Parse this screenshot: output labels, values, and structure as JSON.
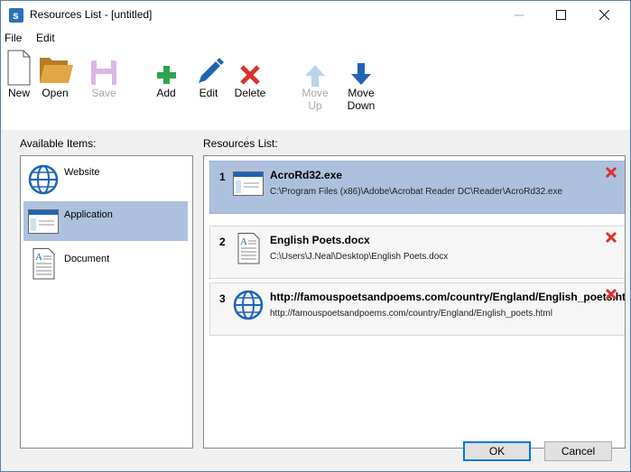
{
  "window": {
    "title": "Resources List - [untitled]",
    "icon": "app-logo-icon",
    "accent": "#2b73b6"
  },
  "menu": [
    "File",
    "Edit"
  ],
  "toolbar": {
    "new": "New",
    "open": "Open",
    "save": "Save",
    "add": "Add",
    "edit": "Edit",
    "delete": "Delete",
    "move_up_1": "Move",
    "move_up_2": "Up",
    "move_down_1": "Move",
    "move_down_2": "Down"
  },
  "available": {
    "label": "Available Items:",
    "items": [
      {
        "label": "Website",
        "icon": "globe-icon"
      },
      {
        "label": "Application",
        "icon": "application-window-icon",
        "selected": true
      },
      {
        "label": "Document",
        "icon": "document-icon"
      }
    ]
  },
  "resources": {
    "label": "Resources List:",
    "items": [
      {
        "num": "1",
        "title": "AcroRd32.exe",
        "path": "C:\\Program Files (x86)\\Adobe\\Acrobat Reader DC\\Reader\\AcroRd32.exe",
        "icon": "application-window-icon",
        "selected": true
      },
      {
        "num": "2",
        "title": "English Poets.docx",
        "path": "C:\\Users\\J.Neal\\Desktop\\English Poets.docx",
        "icon": "document-icon"
      },
      {
        "num": "3",
        "title": "http://famouspoetsandpoems.com/country/England/English_poets.html",
        "path": "http://famouspoetsandpoems.com/country/England/English_poets.html",
        "icon": "globe-icon"
      }
    ]
  },
  "buttons": {
    "ok": "OK",
    "cancel": "Cancel"
  },
  "colors": {
    "selection": "#adc1de",
    "delete_red": "#d9322b",
    "add_green": "#2da44e",
    "blue": "#1e64b4"
  }
}
